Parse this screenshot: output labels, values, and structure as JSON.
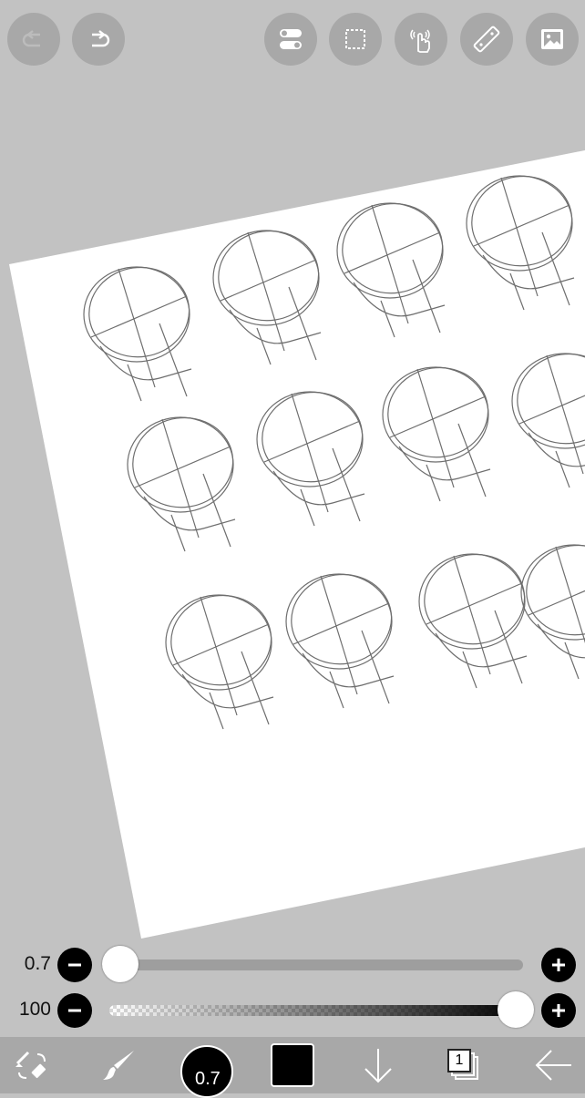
{
  "toolbar_top": {
    "buttons": [
      {
        "name": "undo-button",
        "icon": "undo-icon",
        "enabled": false
      },
      {
        "name": "redo-button",
        "icon": "redo-icon",
        "enabled": true
      },
      {
        "name": "tools-toggle-button",
        "icon": "toggle-icon",
        "enabled": true
      },
      {
        "name": "selection-button",
        "icon": "selection-icon",
        "enabled": true
      },
      {
        "name": "gesture-button",
        "icon": "finger-tap-icon",
        "enabled": true
      },
      {
        "name": "ruler-button",
        "icon": "ruler-icon",
        "enabled": true
      },
      {
        "name": "image-button",
        "icon": "image-icon",
        "enabled": true
      }
    ]
  },
  "sliders": {
    "brush_size": {
      "value_label": "0.7",
      "level": 0.0
    },
    "opacity": {
      "value_label": "100",
      "level": 1.0
    }
  },
  "bottom_toolbar": {
    "brush_size_label": "0.7",
    "current_color": "#000000",
    "layer_count": "1"
  },
  "colors": {
    "background": "#c2c2c2",
    "button": "#a8a8a8",
    "paper": "#ffffff",
    "sketch_stroke": "#6e6e6e"
  }
}
